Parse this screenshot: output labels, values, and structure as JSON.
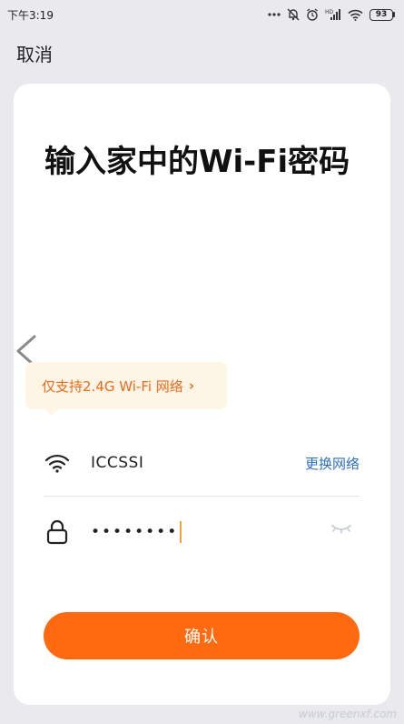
{
  "status_bar": {
    "time": "下午3:19",
    "battery": "93",
    "network_label": "HD"
  },
  "header": {
    "cancel_label": "取消"
  },
  "page": {
    "title": "输入家中的Wi-Fi密码"
  },
  "tooltip": {
    "text": "仅支持2.4G Wi-Fi 网络",
    "chevron": "›"
  },
  "wifi_row": {
    "ssid": "ICCSSI",
    "change_label": "更换网络",
    "icon": "wifi-icon"
  },
  "password_row": {
    "masked_value": "••••••••",
    "icon": "lock-icon",
    "toggle_icon": "eye-closed-icon"
  },
  "confirm_button": {
    "label": "确认"
  },
  "watermark": {
    "text": "www.greenxf.com"
  },
  "colors": {
    "accent": "#ff6a10",
    "link": "#2e6fbf",
    "tooltip_bg": "#fdf5e6",
    "tooltip_text": "#ea6a1b",
    "background": "#e9e9ee"
  }
}
